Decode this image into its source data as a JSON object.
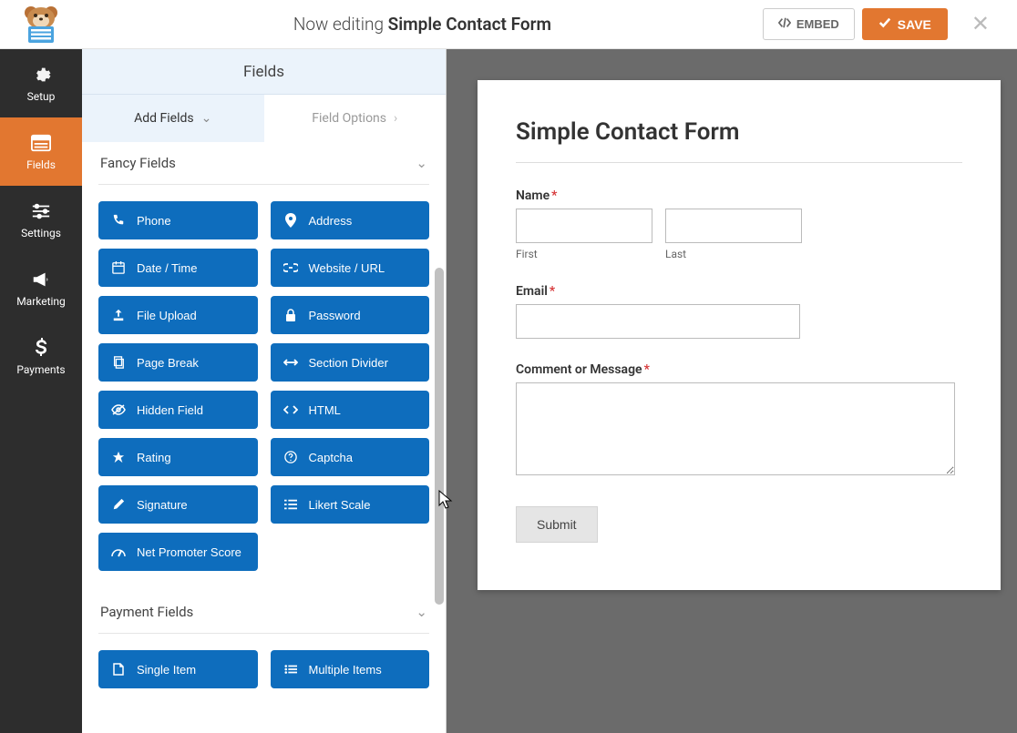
{
  "header": {
    "editing_prefix": "Now editing",
    "form_name": "Simple Contact Form",
    "embed_label": "EMBED",
    "save_label": "SAVE"
  },
  "sidebar": {
    "items": [
      {
        "label": "Setup",
        "icon": "gear"
      },
      {
        "label": "Fields",
        "icon": "form"
      },
      {
        "label": "Settings",
        "icon": "sliders"
      },
      {
        "label": "Marketing",
        "icon": "bullhorn"
      },
      {
        "label": "Payments",
        "icon": "dollar"
      }
    ],
    "active_index": 1
  },
  "fields_panel": {
    "title": "Fields",
    "tabs": {
      "add": "Add Fields",
      "options": "Field Options"
    },
    "sections": {
      "fancy": {
        "title": "Fancy Fields",
        "items": [
          {
            "label": "Phone",
            "icon": "phone"
          },
          {
            "label": "Address",
            "icon": "map-marker"
          },
          {
            "label": "Date / Time",
            "icon": "calendar"
          },
          {
            "label": "Website / URL",
            "icon": "link"
          },
          {
            "label": "File Upload",
            "icon": "upload"
          },
          {
            "label": "Password",
            "icon": "lock"
          },
          {
            "label": "Page Break",
            "icon": "files"
          },
          {
            "label": "Section Divider",
            "icon": "arrows-h"
          },
          {
            "label": "Hidden Field",
            "icon": "eye-slash"
          },
          {
            "label": "HTML",
            "icon": "code"
          },
          {
            "label": "Rating",
            "icon": "star"
          },
          {
            "label": "Captcha",
            "icon": "question-circle"
          },
          {
            "label": "Signature",
            "icon": "pencil"
          },
          {
            "label": "Likert Scale",
            "icon": "list"
          },
          {
            "label": "Net Promoter Score",
            "icon": "tachometer"
          }
        ]
      },
      "payment": {
        "title": "Payment Fields",
        "items": [
          {
            "label": "Single Item",
            "icon": "file-o"
          },
          {
            "label": "Multiple Items",
            "icon": "list-ul"
          }
        ]
      }
    }
  },
  "preview": {
    "form_title": "Simple Contact Form",
    "name_label": "Name",
    "first_sub": "First",
    "last_sub": "Last",
    "email_label": "Email",
    "comment_label": "Comment or Message",
    "submit_label": "Submit"
  }
}
